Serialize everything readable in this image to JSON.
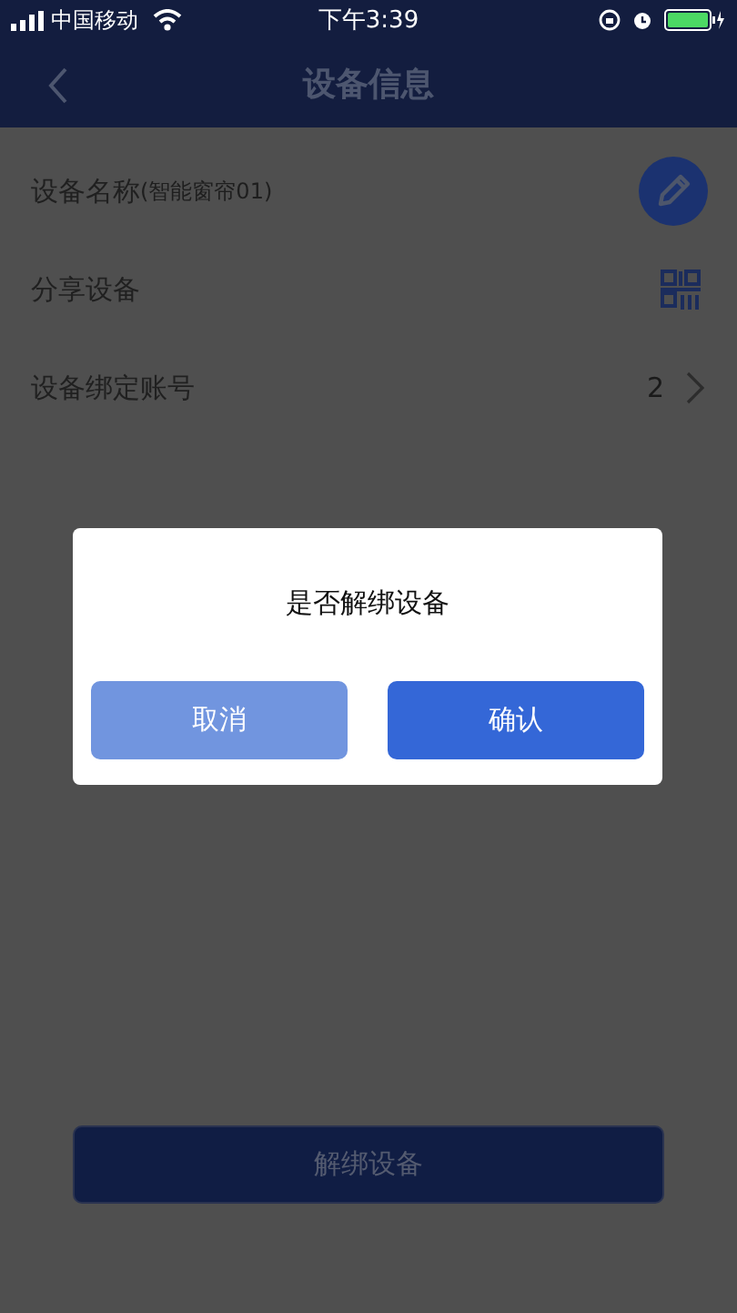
{
  "status_bar": {
    "carrier": "中国移动",
    "time": "下午3:39"
  },
  "nav": {
    "title": "设备信息"
  },
  "rows": [
    {
      "kind": "edit",
      "label": "设备名称",
      "note": "(智能窗帘01)"
    },
    {
      "kind": "qr",
      "label": "分享设备"
    },
    {
      "kind": "count",
      "label": "设备绑定账号",
      "value": "2"
    }
  ],
  "unbind_button": "解绑设备",
  "dialog": {
    "message": "是否解绑设备",
    "buttons": [
      {
        "label": "取消",
        "kind": "cancel"
      },
      {
        "label": "确认",
        "kind": "confirm"
      }
    ]
  }
}
